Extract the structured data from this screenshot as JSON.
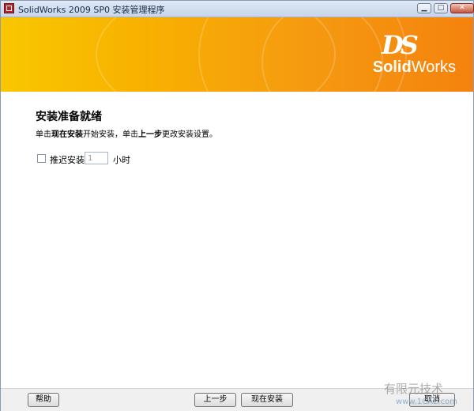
{
  "window": {
    "title": "SolidWorks 2009 SP0 安装管理程序",
    "minimize_glyph": "▁",
    "maximize_glyph": "□",
    "close_glyph": "✕"
  },
  "banner": {
    "logo_mark": "DS",
    "brand_prefix": "Solid",
    "brand_suffix": "Works",
    "gradient_start": "#f8c700",
    "gradient_end": "#f5820e"
  },
  "content": {
    "heading": "安装准备就绪",
    "instruction": {
      "part1": "单击",
      "bold1": "现在安装",
      "part2": "开始安装，单击",
      "bold2": "上一步",
      "part3": "更改安装设置。"
    },
    "delay": {
      "label": "推迟安装",
      "value": "1",
      "unit": "小时",
      "checked": false
    }
  },
  "footer": {
    "help_label": "帮助",
    "back_label": "上一步",
    "install_label": "现在安装",
    "cancel_label": "取消"
  },
  "watermark": {
    "line1": "有限元技术",
    "line2": "www.1CAE.com"
  }
}
